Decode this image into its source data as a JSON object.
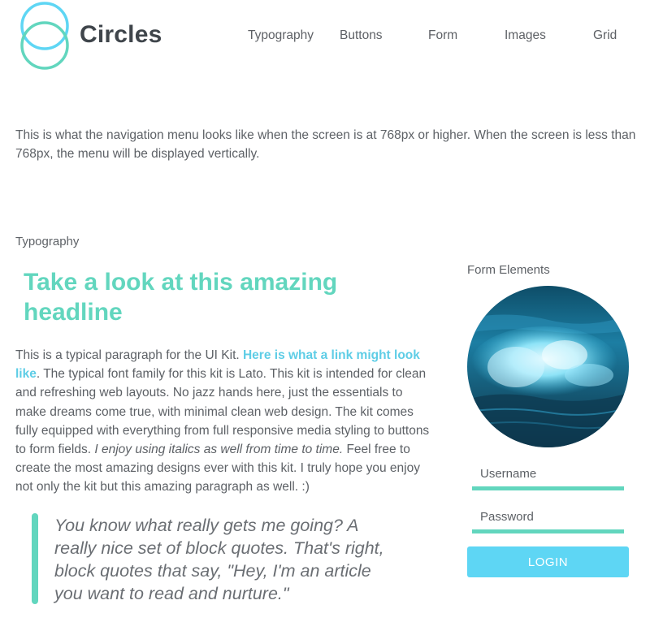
{
  "brand": {
    "name": "Circles",
    "logo_icon": "interlocking-circles-logo",
    "accent": "#62d6be",
    "accent2": "#5ed6f4"
  },
  "nav": {
    "items": [
      {
        "label": "Typography"
      },
      {
        "label": "Buttons"
      },
      {
        "label": "Form"
      },
      {
        "label": "Images"
      },
      {
        "label": "Grid"
      }
    ]
  },
  "intro": {
    "text": "This is what the navigation menu looks like when the screen is at 768px or higher. When the screen is less than 768px, the menu will be displayed vertically."
  },
  "typography": {
    "section_label": "Typography",
    "headline": "Take a look at this amazing headline",
    "paragraph": {
      "part1": "This is a typical paragraph for the UI Kit. ",
      "link": "Here is what a link might look like",
      "part2": ". The typical font family for this kit is Lato. This kit is intended for clean and refreshing web layouts. No jazz hands here, just the essentials to make dreams come true, with minimal clean web design. The kit comes fully equipped with everything from full responsive media styling to buttons to form fields. ",
      "italic": "I enjoy using italics as well from time to time.",
      "part3": " Feel free to create the most amazing designs ever with this kit. I truly hope you enjoy not only the kit but this amazing paragraph as well. :)"
    },
    "blockquote": "You know what really gets me going? A really nice set of block quotes. That's right, block quotes that say, \"Hey, I'm an article you want to read and nurture.\""
  },
  "form": {
    "section_label": "Form Elements",
    "image": "ocean-wave-photo",
    "username_placeholder": "Username",
    "password_placeholder": "Password",
    "login_label": "LOGIN"
  }
}
